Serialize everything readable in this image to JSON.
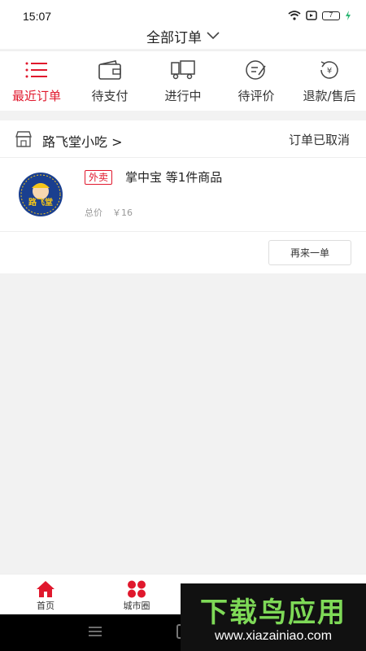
{
  "status_bar": {
    "time": "15:07",
    "battery": "7"
  },
  "header": {
    "title": "全部订单"
  },
  "tabs": [
    {
      "label": "最近订单",
      "icon": "list-icon",
      "active": true
    },
    {
      "label": "待支付",
      "icon": "wallet-icon",
      "active": false
    },
    {
      "label": "进行中",
      "icon": "truck-icon",
      "active": false
    },
    {
      "label": "待评价",
      "icon": "review-icon",
      "active": false
    },
    {
      "label": "退款/售后",
      "icon": "refund-icon",
      "active": false
    }
  ],
  "order": {
    "shop_name": "路飞堂小吃 >",
    "status": "订单已取消",
    "logo_text": "路飞堂",
    "tag": "外卖",
    "goods": "掌中宝 等1件商品",
    "total_label": "总价",
    "total_value": "￥16",
    "reorder_label": "再来一单"
  },
  "bottom_nav": [
    {
      "label": "首页",
      "icon": "home-icon"
    },
    {
      "label": "城市圈",
      "icon": "apps-icon"
    }
  ],
  "watermark": {
    "title": "下载鸟应用",
    "url": "www.xiazainiao.com"
  },
  "colors": {
    "accent": "#e0182d",
    "logo_blue": "#1a3f8f",
    "logo_yellow": "#f5c518"
  }
}
